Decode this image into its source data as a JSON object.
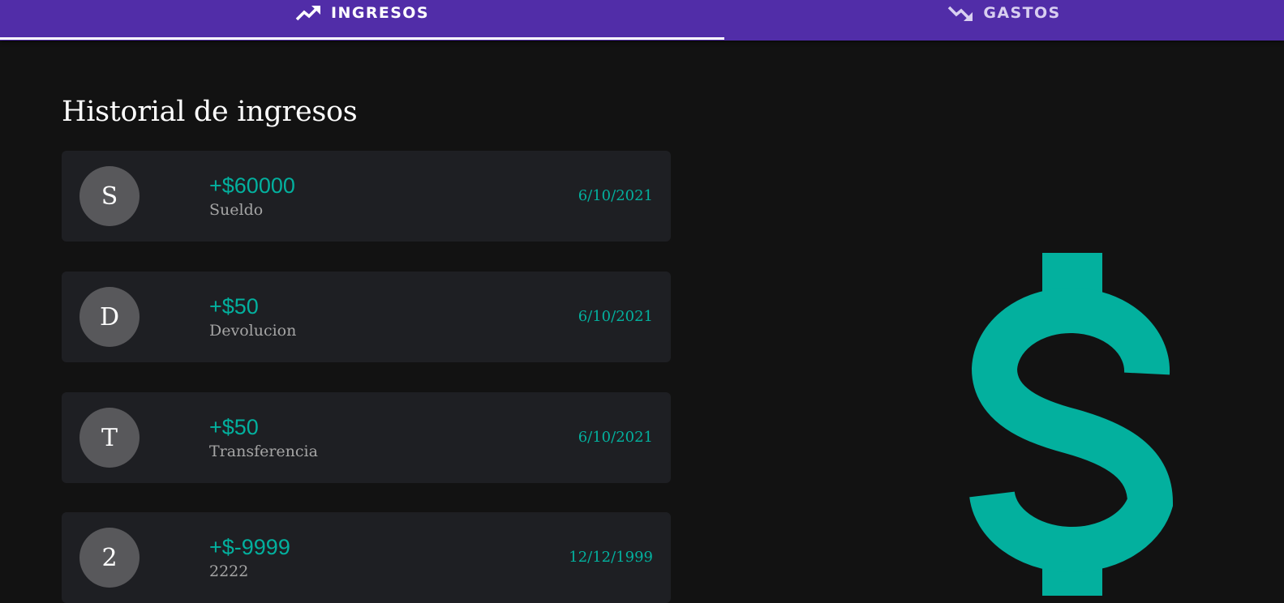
{
  "tabs": {
    "ingresos": {
      "label": "INGRESOS",
      "icon": "trending-up-icon",
      "active": true
    },
    "gastos": {
      "label": "GASTOS",
      "icon": "trending-down-icon",
      "active": false
    }
  },
  "page": {
    "title": "Historial de ingresos"
  },
  "income_history": [
    {
      "initial": "S",
      "amount": "+$60000",
      "concept": "Sueldo",
      "date": "6/10/2021"
    },
    {
      "initial": "D",
      "amount": "+$50",
      "concept": "Devolucion",
      "date": "6/10/2021"
    },
    {
      "initial": "T",
      "amount": "+$50",
      "concept": "Transferencia",
      "date": "6/10/2021"
    },
    {
      "initial": "2",
      "amount": "+$-9999",
      "concept": "2222",
      "date": "12/12/1999"
    }
  ],
  "decoration": {
    "icon": "dollar-sign-icon"
  },
  "colors": {
    "tab_bar": "#512DA8",
    "background": "#121212",
    "card": "#1e1f23",
    "accent": "#03b09e",
    "avatar": "#58585b"
  }
}
